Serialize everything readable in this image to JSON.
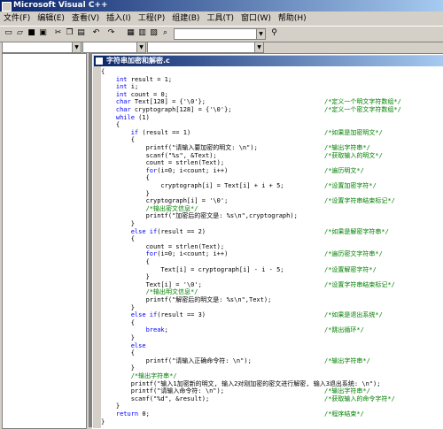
{
  "window": {
    "title": "Microsoft Visual C++"
  },
  "menu": [
    "文件(F)",
    "编辑(E)",
    "查看(V)",
    "插入(I)",
    "工程(P)",
    "组建(B)",
    "工具(T)",
    "窗口(W)",
    "帮助(H)"
  ],
  "toolbar": {
    "icons": [
      "new-file-icon",
      "open-icon",
      "save-icon",
      "save-all-icon",
      "cut-icon",
      "copy-icon",
      "paste-icon",
      "undo-icon",
      "redo-icon",
      "workspace-icon",
      "output-icon",
      "window-list-icon",
      "find-in-files-icon"
    ],
    "find_combo_value": "",
    "class_combo_value": "",
    "members_combo_value": ""
  },
  "document": {
    "title": "字符串加密和解密.c"
  },
  "code_lines": [
    {
      "code": "{",
      "kw": "",
      "comment": ""
    },
    {
      "code": "    int result = 1;",
      "kw": "int",
      "comment": ""
    },
    {
      "code": "    int i;",
      "kw": "int",
      "comment": ""
    },
    {
      "code": "    int count = 0;",
      "kw": "int",
      "comment": ""
    },
    {
      "code": "    char Text[128] = {'\\0'};",
      "kw": "char",
      "comment": "/*定义一个明文字符数组*/"
    },
    {
      "code": "    char cryptograph[128] = {'\\0'};",
      "kw": "char",
      "comment": "/*定义一个密文字符数组*/"
    },
    {
      "code": "    while (1)",
      "kw": "while",
      "comment": ""
    },
    {
      "code": "    {",
      "kw": "",
      "comment": ""
    },
    {
      "code": "        if (result == 1)",
      "kw": "if",
      "comment": "/*如果是加密明文*/"
    },
    {
      "code": "        {",
      "kw": "",
      "comment": ""
    },
    {
      "code": "            printf(\"请输入要加密的明文: \\n\");",
      "kw": "",
      "comment": "/*输出字符串*/"
    },
    {
      "code": "            scanf(\"%s\", &Text);",
      "kw": "",
      "comment": "/*获取输入的明文*/"
    },
    {
      "code": "            count = strlen(Text);",
      "kw": "",
      "comment": ""
    },
    {
      "code": "            for(i=0; i<count; i++)",
      "kw": "for",
      "comment": "/*遍历明文*/"
    },
    {
      "code": "            {",
      "kw": "",
      "comment": ""
    },
    {
      "code": "                cryptograph[i] = Text[i] + i + 5;",
      "kw": "",
      "comment": "/*设置加密字符*/"
    },
    {
      "code": "            }",
      "kw": "",
      "comment": ""
    },
    {
      "code": "            cryptograph[i] = '\\0';",
      "kw": "",
      "comment": "/*设置字符串结束标记*/"
    },
    {
      "code": "            /*输出密文信息*/",
      "kw": "",
      "comment": ""
    },
    {
      "code": "            printf(\"加密后的密文是: %s\\n\",cryptograph);",
      "kw": "",
      "comment": ""
    },
    {
      "code": "        }",
      "kw": "",
      "comment": ""
    },
    {
      "code": "        else if(result == 2)",
      "kw": "else if",
      "comment": "/*如果是解密字符串*/"
    },
    {
      "code": "        {",
      "kw": "",
      "comment": ""
    },
    {
      "code": "            count = strlen(Text);",
      "kw": "",
      "comment": ""
    },
    {
      "code": "            for(i=0; i<count; i++)",
      "kw": "for",
      "comment": "/*遍历密文字符串*/"
    },
    {
      "code": "            {",
      "kw": "",
      "comment": ""
    },
    {
      "code": "                Text[i] = cryptograph[i] - i - 5;",
      "kw": "",
      "comment": "/*设置解密字符*/"
    },
    {
      "code": "            }",
      "kw": "",
      "comment": ""
    },
    {
      "code": "            Text[i] = '\\0';",
      "kw": "",
      "comment": "/*设置字符串结束标记*/"
    },
    {
      "code": "            /*输出明文信息*/",
      "kw": "",
      "comment": ""
    },
    {
      "code": "            printf(\"解密后的明文是: %s\\n\",Text);",
      "kw": "",
      "comment": ""
    },
    {
      "code": "        }",
      "kw": "",
      "comment": ""
    },
    {
      "code": "        else if(result == 3)",
      "kw": "else if",
      "comment": "/*如果是退出系统*/"
    },
    {
      "code": "        {",
      "kw": "",
      "comment": ""
    },
    {
      "code": "            break;",
      "kw": "break",
      "comment": "/*跳出循环*/"
    },
    {
      "code": "        }",
      "kw": "",
      "comment": ""
    },
    {
      "code": "        else",
      "kw": "else",
      "comment": ""
    },
    {
      "code": "        {",
      "kw": "",
      "comment": ""
    },
    {
      "code": "            printf(\"请输入正确命令符: \\n\");",
      "kw": "",
      "comment": "/*输出字符串*/"
    },
    {
      "code": "        }",
      "kw": "",
      "comment": ""
    },
    {
      "code": "        /*输出字符串*/",
      "kw": "",
      "comment": ""
    },
    {
      "code": "        printf(\"输入1加密新的明文, 输入2对刚加密的密文进行解密, 输入3退出系统: \\n\");",
      "kw": "",
      "comment": ""
    },
    {
      "code": "        printf(\"请输入命令符: \\n\");",
      "kw": "",
      "comment": "/*输出字符串*/"
    },
    {
      "code": "        scanf(\"%d\", &result);",
      "kw": "",
      "comment": "/*获取输入的命令字符*/"
    },
    {
      "code": "    }",
      "kw": "",
      "comment": ""
    },
    {
      "code": "    return 0;",
      "kw": "return",
      "comment": "/*程序结束*/"
    },
    {
      "code": "}",
      "kw": "",
      "comment": ""
    }
  ]
}
